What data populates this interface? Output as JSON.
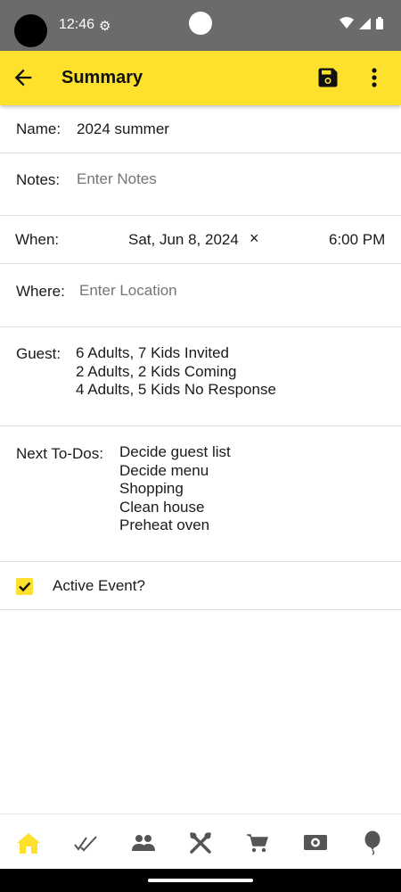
{
  "status_bar": {
    "time": "12:46"
  },
  "app_bar": {
    "title": "Summary"
  },
  "form": {
    "name": {
      "label": "Name:",
      "value": "2024 summer"
    },
    "notes": {
      "label": "Notes:",
      "placeholder": "Enter Notes"
    },
    "when": {
      "label": "When:",
      "date": "Sat, Jun 8, 2024",
      "clear": "×",
      "time": "6:00 PM"
    },
    "where": {
      "label": "Where:",
      "placeholder": "Enter Location"
    },
    "guest": {
      "label": "Guest:",
      "lines": [
        "6 Adults, 7 Kids Invited",
        "2 Adults, 2 Kids Coming",
        "4 Adults, 5 Kids No Response"
      ]
    },
    "todos": {
      "label": "Next To-Dos:",
      "items": [
        "Decide guest list",
        "Decide menu",
        "Shopping",
        "Clean house",
        "Preheat oven"
      ]
    },
    "active": {
      "label": "Active Event?",
      "checked": true
    }
  },
  "bottom_nav": {
    "items": [
      "home-icon",
      "checkmarks-icon",
      "people-icon",
      "utensils-icon",
      "cart-icon",
      "money-icon",
      "balloon-icon"
    ]
  },
  "colors": {
    "accent": "#fde12d",
    "status_bar": "#6b6b6b"
  }
}
